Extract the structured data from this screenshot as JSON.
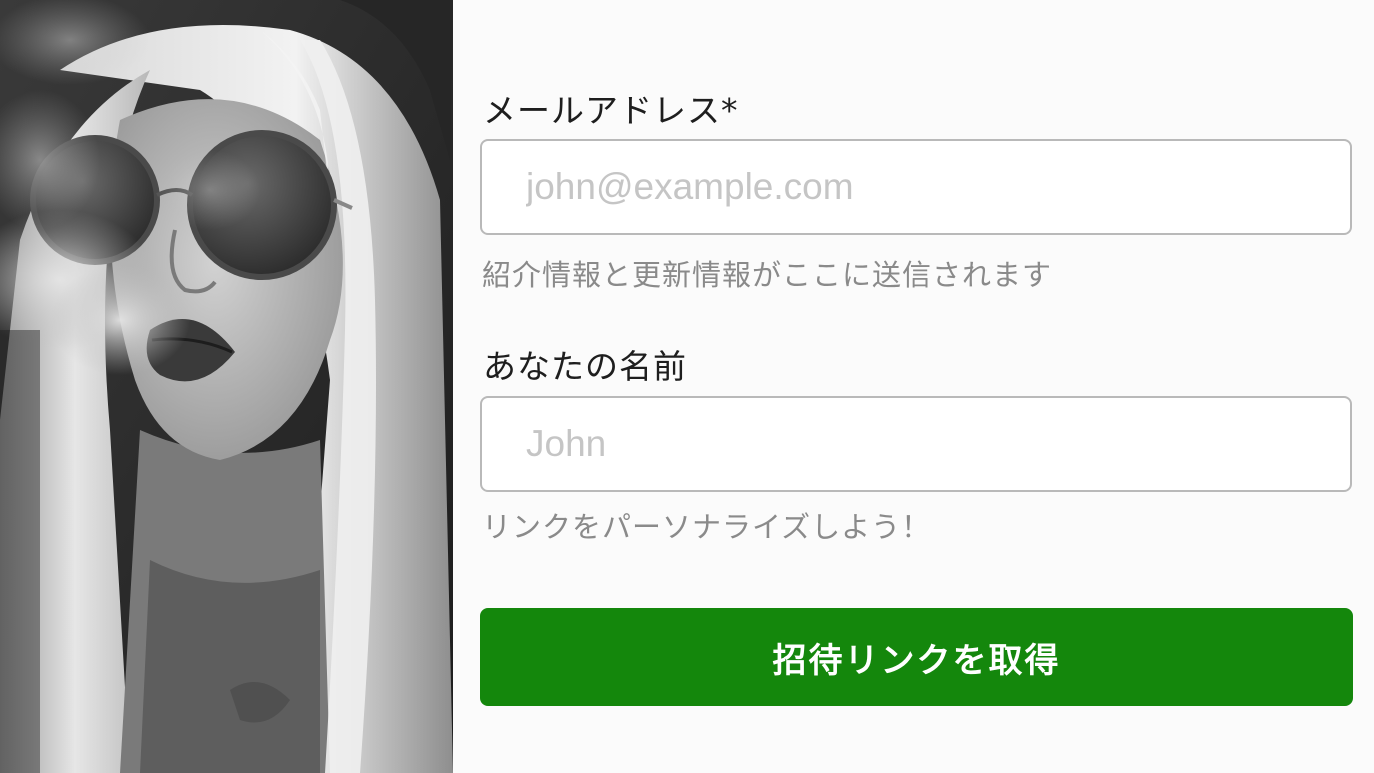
{
  "photo": {
    "alt": "black-and-white portrait photo"
  },
  "email": {
    "label": "メールアドレス*",
    "placeholder": "john@example.com",
    "value": "",
    "hint": "紹介情報と更新情報がここに送信されます"
  },
  "name": {
    "label": "あなたの名前",
    "placeholder": "John",
    "value": "",
    "hint": "リンクをパーソナライズしよう！"
  },
  "submit": {
    "label": "招待リンクを取得"
  },
  "colors": {
    "button": "#14870c",
    "button_text": "#ffffff",
    "label": "#1e1e1e",
    "hint": "#8a8a8a",
    "input_border": "#b9b9b9",
    "placeholder": "#c5c5c5",
    "background": "#fbfbfb"
  }
}
